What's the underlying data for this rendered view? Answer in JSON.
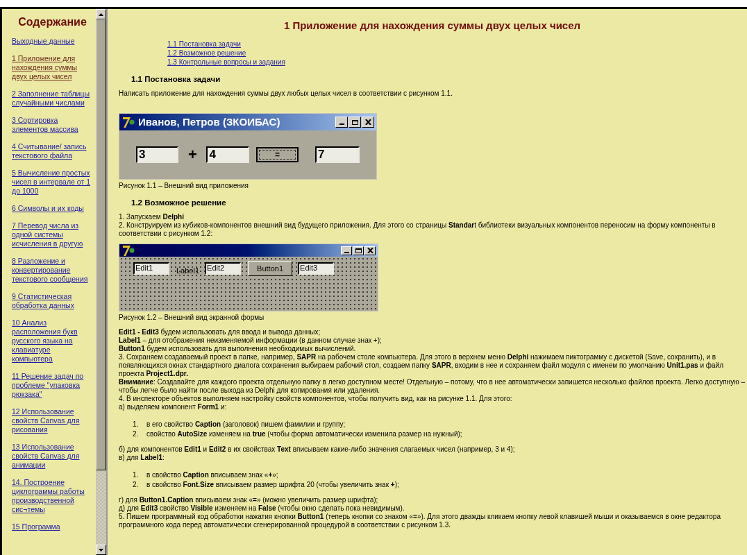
{
  "sidebar": {
    "title": "Содержание",
    "items": [
      {
        "label": "Выходные данные",
        "selected": false
      },
      {
        "label": "1 Приложение для нахождения суммы двух целых чисел",
        "selected": true
      },
      {
        "label": "2 Заполнение таблицы случайными числами",
        "selected": false
      },
      {
        "label": "3 Сортировка элементов массива",
        "selected": false
      },
      {
        "label": "4 Считывание/ запись текстового файла",
        "selected": false
      },
      {
        "label": "5 Вычисление простых чисел в интервале от 1 до 1000",
        "selected": false
      },
      {
        "label": "6 Символы и их коды",
        "selected": false
      },
      {
        "label": "7 Перевод числа из одной системы исчисления в другую",
        "selected": false
      },
      {
        "label": "8 Разложение и конвертирование текстового сообщения",
        "selected": false
      },
      {
        "label": "9 Статистическая обработка данных",
        "selected": false
      },
      {
        "label": "10 Анализ расположения букв русского языка на клавиатуре компьютера",
        "selected": false
      },
      {
        "label": "11 Решение задач по проблеме \"упаковка рюкзака\"",
        "selected": false
      },
      {
        "label": "12 Использование свойств Canvas для рисования",
        "selected": false
      },
      {
        "label": "13 Использование свойств Canvas для анимации",
        "selected": false
      },
      {
        "label": "14. Построение циклограммы работы производственной сис¬темы",
        "selected": false
      },
      {
        "label": "15 Программа",
        "selected": false
      }
    ]
  },
  "main": {
    "title": "1 Приложение для нахождения суммы двух целых чисел",
    "toc": [
      "1.1 Постановка задачи",
      "1.2 Возможное решение",
      "1.3 Контрольные вопросы и задания"
    ],
    "blocks": [
      {
        "kind": "heading",
        "text": "1.1 Постановка задачи"
      },
      {
        "kind": "text",
        "lines": [
          "Написать приложение для нахождения суммы двух любых целых чисел в соответствии с рисунком 1.1."
        ]
      },
      {
        "kind": "app",
        "title": "Иванов, Петров (ЗКОИБАС)",
        "first": "3",
        "operator": "+",
        "second": "4",
        "button": "=",
        "result": "7"
      },
      {
        "kind": "caption",
        "text": "Рисунок 1.1 – Внешний вид приложения"
      },
      {
        "kind": "heading",
        "text": "1.2 Возможное решение"
      },
      {
        "kind": "text",
        "lines": [
          "1. Запускаем **Delphi**",
          "2. Конструируем из кубиков-компонентов внешний вид будущего приложения. Для этого со страницы **Standar**t библиотеки визуальных компонентов переносим на форму компоненты в соответствии с рисунком 1.2:"
        ]
      },
      {
        "kind": "form",
        "edits": [
          "Edit1",
          "Edit2",
          "Edit3"
        ],
        "label": "Label1",
        "button": "Button1"
      },
      {
        "kind": "caption",
        "text": "Рисунок 1.2 – Внешний вид экранной формы"
      },
      {
        "kind": "text",
        "lines": [
          "**Edit1 - Edit3** будем использовать для ввода и вывода данных;",
          "**Label1** – для отображения неизменяемой информации (в данном случае знак +);",
          "**Button1** будем использовать для выполнения необходимых вычислений.",
          "3. Сохраняем создаваемый проект в папке, например, **SAPR** на рабочем столе компьютера. Для этого в верхнем меню **Delphi** нажимаем пиктограмму с дискетой (Save, сохранить), и в появляющихся окнах стандартного диалога сохранения выбираем рабочий стол, создаем папку **SAPR**, входим в нее и сохраняем файл модуля с именем по умолчанию **Unit1.pas** и файл проекта **Project1.dpr.**",
          "**Внимание**: Создавайте для каждого проекта отдельную папку в легко доступном месте! Отдельную – потому, что в нее автоматически запишется несколько файлов проекта. Легко доступную – чтобы легче было найти после выхода из Delphi для копирования или удаления.",
          "4. В инспекторе объектов выполняем настройку свойств компонентов, чтобы получить вид, как на рисунке 1.1. Для этого:",
          "а) выделяем компонент **Form1** и:"
        ]
      },
      {
        "kind": "list",
        "items": [
          {
            "number": "1.",
            "text": "в его свойство **Caption** (заголовок) пишем фамилии и группу;"
          },
          {
            "number": "2.",
            "text": "свойство **AutoSize** изменяем на **true** (чтобы форма автоматически изменила размер на нужный);"
          }
        ]
      },
      {
        "kind": "text",
        "lines": [
          "б) для компонентов **Edit1** и **Edit2** в их свойствах **Text** вписываем какие-либо значения слагаемых чисел (например, 3 и 4);",
          "в) для **Label1**:"
        ]
      },
      {
        "kind": "list",
        "items": [
          {
            "number": "1.",
            "text": "в свойство **Caption** вписываем знак «**+**»;"
          },
          {
            "number": "2.",
            "text": "в свойство **Font.Size** вписываем размер шрифта 20 (чтобы увеличить знак **+**);"
          }
        ]
      },
      {
        "kind": "text",
        "lines": [
          "г) для  **Button1.Caption** вписываем знак «**=**» (можно увеличить размер шрифта);",
          "д) для **Edit3** свойство **Visible** изменяем на **False** (чтобы окно сделать пока невидимым).",
          "5. Пишем программный код обработки нажатия кнопки **Button1** (теперь кнопки со знаком «**=**»). Для этого дважды кликаем кнопку левой клавишей мыши и оказываемся в окне редактора программного кода перед автоматически сгенерированной процедурой в соответствии с рисунком 1.3."
        ]
      }
    ]
  }
}
